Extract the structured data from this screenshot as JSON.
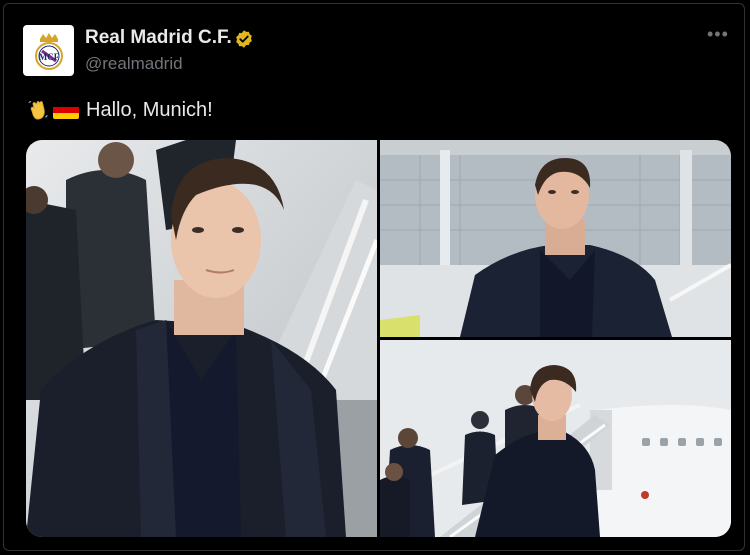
{
  "post": {
    "author_name": "Real Madrid C.F.",
    "author_handle": "@realmadrid",
    "more_label": "•••",
    "text": "Hallo, Munich!",
    "emojis": [
      "waving-hand",
      "germany-flag"
    ]
  },
  "colors": {
    "background": "#000000",
    "text_primary": "#e7e9ea",
    "text_secondary": "#71767b",
    "verified_badge": "#e2b719",
    "border": "#2f3336"
  },
  "media": {
    "photos": [
      {
        "name": "player-portrait-stairs"
      },
      {
        "name": "player-airport-tarmac"
      },
      {
        "name": "team-descending-plane"
      }
    ]
  }
}
